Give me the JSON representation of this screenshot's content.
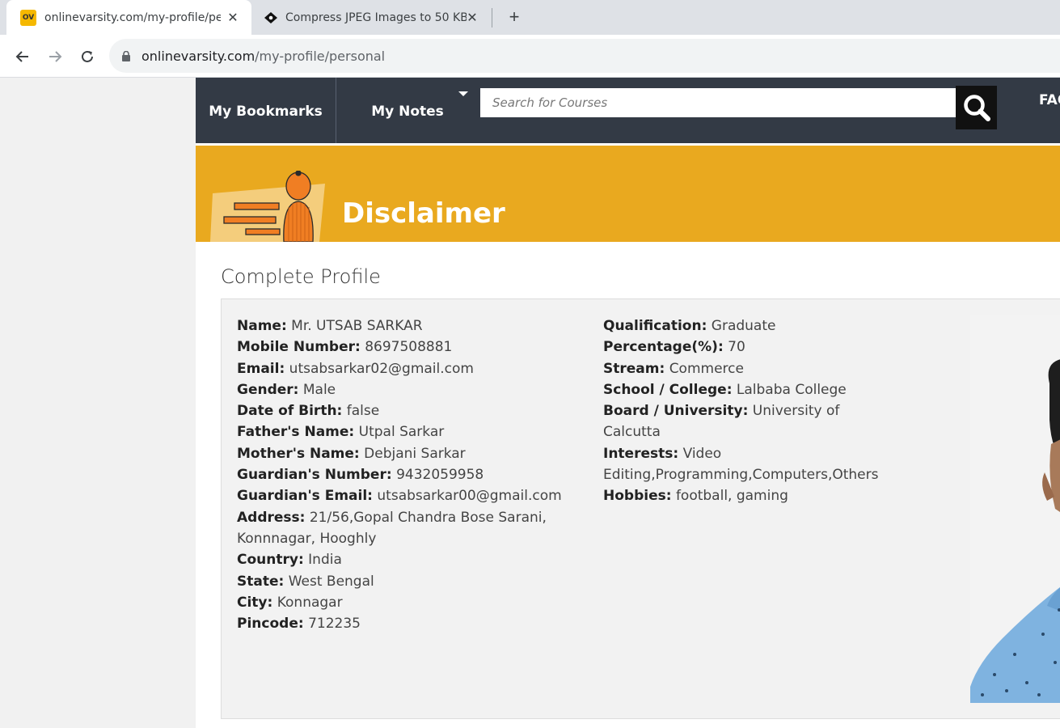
{
  "browser": {
    "tabs": [
      {
        "favicon": "ov-logo-icon",
        "favicon_text": "OV",
        "title": "onlinevarsity.com/my-profile/personal",
        "active": true
      },
      {
        "favicon": "diamond-logo-icon",
        "title": "Compress JPEG Images to 50 KB",
        "active": false
      }
    ],
    "url_host": "onlinevarsity.com",
    "url_path": "/my-profile/personal"
  },
  "site_nav": {
    "bookmarks": "My Bookmarks",
    "notes": "My Notes",
    "search_placeholder": "Search for Courses",
    "faq": "FAQ"
  },
  "banner": {
    "title": "Disclaimer",
    "color": "#e9a91f"
  },
  "profile": {
    "section_title": "Complete Profile",
    "left": [
      {
        "label": "Name:",
        "value": "Mr. UTSAB SARKAR"
      },
      {
        "label": "Mobile Number:",
        "value": "8697508881"
      },
      {
        "label": "Email:",
        "value": "utsabsarkar02@gmail.com"
      },
      {
        "label": "Gender:",
        "value": "Male"
      },
      {
        "label": "Date of Birth:",
        "value": "false"
      },
      {
        "label": "Father's Name:",
        "value": "Utpal Sarkar"
      },
      {
        "label": "Mother's Name:",
        "value": "Debjani Sarkar"
      },
      {
        "label": "Guardian's Number:",
        "value": "9432059958"
      },
      {
        "label": "Guardian's Email:",
        "value": "utsabsarkar00@gmail.com"
      },
      {
        "label": "Address:",
        "value": "21/56,Gopal Chandra Bose Sarani, Konnnagar, Hooghly"
      },
      {
        "label": "Country:",
        "value": "India"
      },
      {
        "label": "State:",
        "value": "West Bengal"
      },
      {
        "label": "City:",
        "value": "Konnagar"
      },
      {
        "label": "Pincode:",
        "value": "712235"
      }
    ],
    "right": [
      {
        "label": "Qualification:",
        "value": "Graduate"
      },
      {
        "label": "Percentage(%):",
        "value": "70"
      },
      {
        "label": "Stream:",
        "value": "Commerce"
      },
      {
        "label": "School / College:",
        "value": "Lalbaba College"
      },
      {
        "label": "Board / University:",
        "value": "University of Calcutta"
      },
      {
        "label": "Interests:",
        "value": "Video Editing,Programming,Computers,Others"
      },
      {
        "label": "Hobbies:",
        "value": "football, gaming"
      }
    ]
  }
}
